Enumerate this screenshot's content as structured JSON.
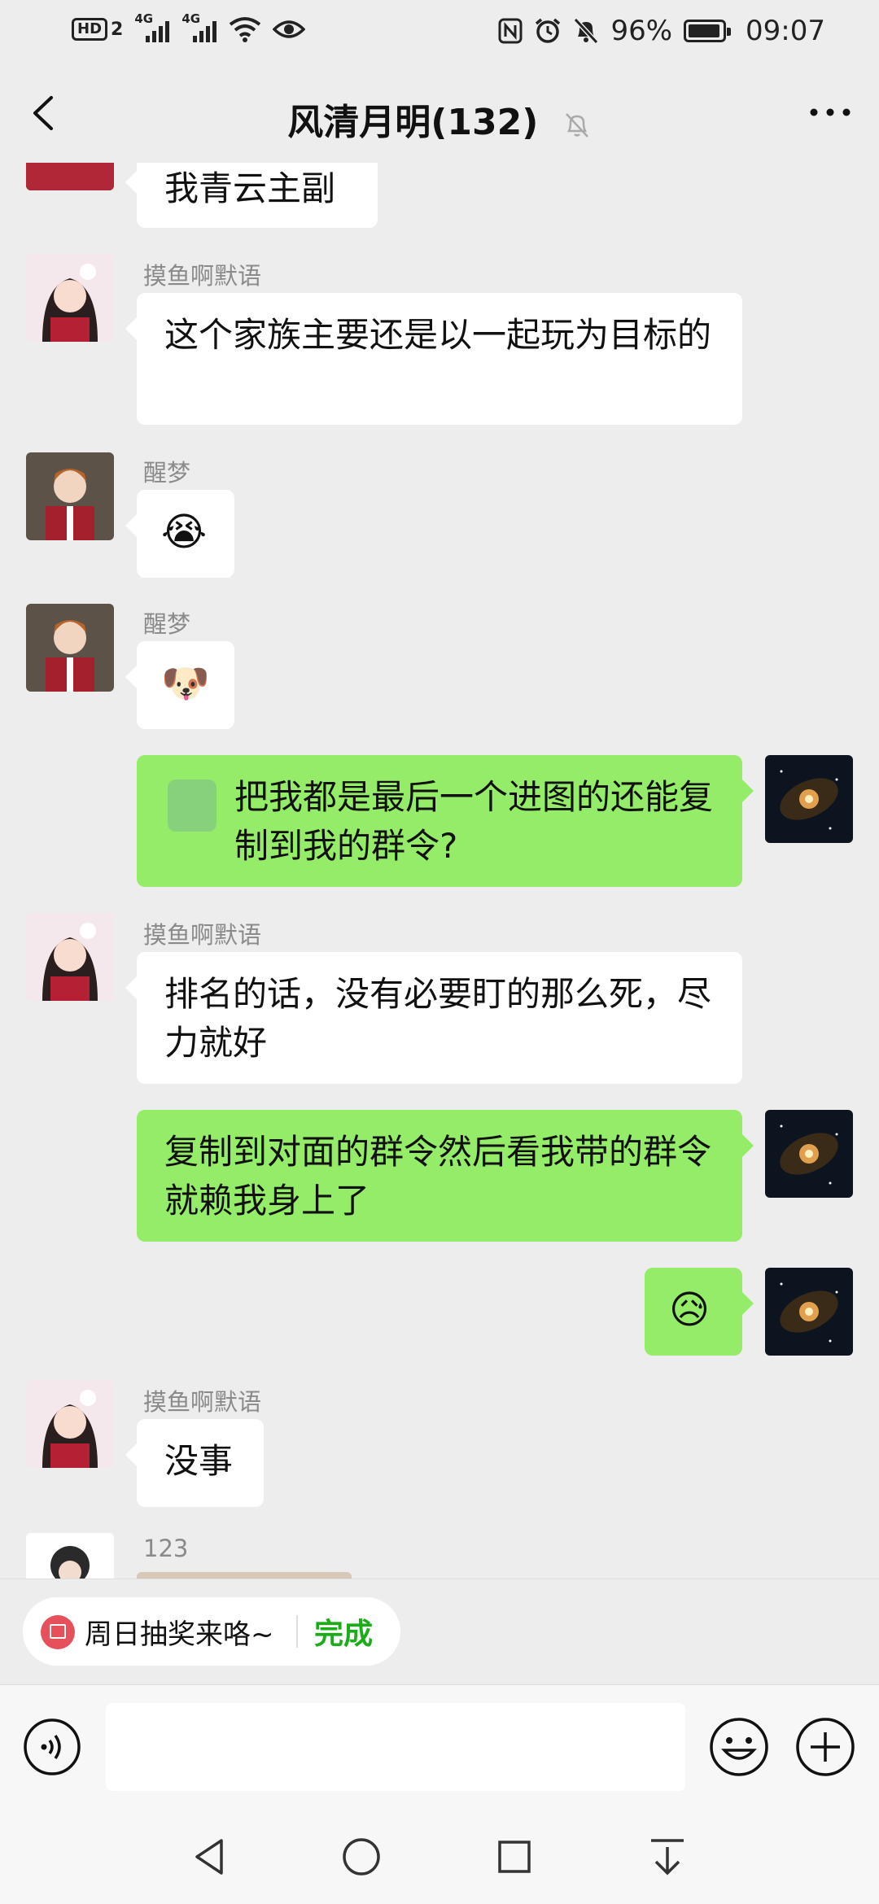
{
  "status_bar": {
    "hd": "HD",
    "sim2": "2",
    "sig1": "4G",
    "sig2": "4G",
    "battery": "96%",
    "battery_level": 0.96,
    "time": "09:07"
  },
  "header": {
    "title": "风清月明(132)"
  },
  "messages": {
    "m1": {
      "text": "我青云主副"
    },
    "m2": {
      "sender": "摸鱼啊默语",
      "text": "这个家族主要还是以一起玩为目标的"
    },
    "m3": {
      "sender": "醒梦",
      "emoji": "😭"
    },
    "m4": {
      "sender": "醒梦",
      "emoji": "🐶"
    },
    "m5": {
      "text": "把我都是最后一个进图的还能复制到我的群令?"
    },
    "m6": {
      "sender": "摸鱼啊默语",
      "text": "排名的话，没有必要盯的那么死，尽力就好"
    },
    "m7": {
      "text": "复制到对面的群令然后看我带的群令就赖我身上了"
    },
    "m8": {
      "emoji": "😥"
    },
    "m9": {
      "sender": "摸鱼啊默语",
      "text": "没事"
    },
    "m10": {
      "sender": "123"
    }
  },
  "quick_bar": {
    "chip_text": "周日抽奖来咯~",
    "chip_action": "完成"
  },
  "input": {
    "value": ""
  },
  "colors": {
    "background": "#ededed",
    "my_bubble": "#95ec69",
    "their_bubble": "#ffffff",
    "accent_green": "#1aad19"
  },
  "icons": {
    "back": "chevron-left-icon",
    "mute": "bell-off-icon",
    "more": "more-dots-icon",
    "voice": "voice-icon",
    "emoji": "emoji-icon",
    "plus": "plus-icon"
  }
}
